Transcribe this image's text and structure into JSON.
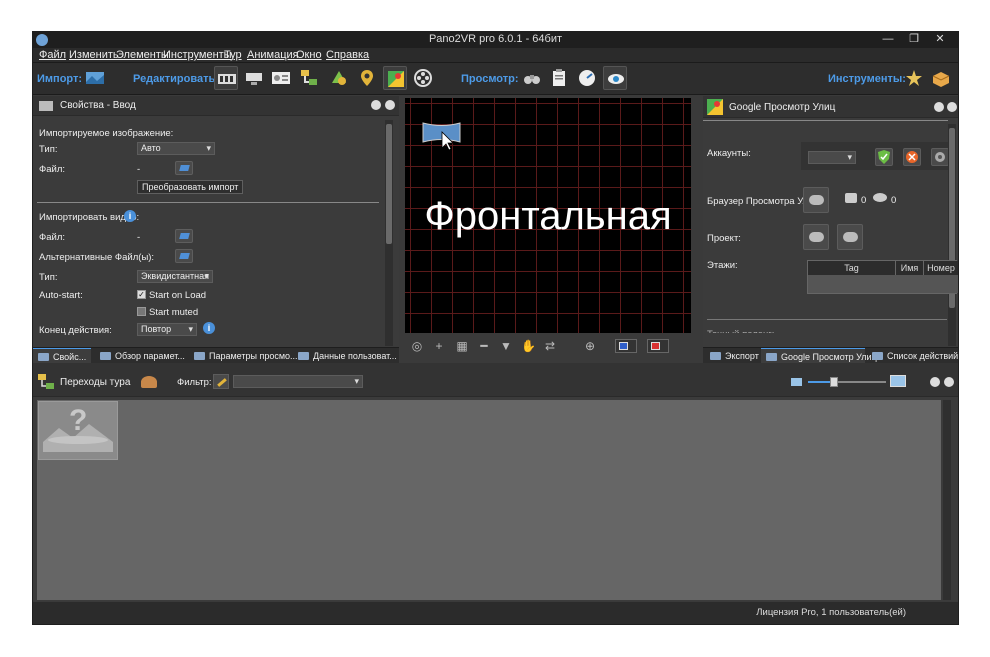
{
  "window": {
    "title": "Pano2VR pro 6.0.1 - 64бит",
    "minimize": "—",
    "maximize": "❐",
    "close": "✕"
  },
  "menu": [
    "Файл",
    "Изменить",
    "Элементы",
    "Инструменты",
    "Тур",
    "Анимация",
    "Окно",
    "Справка"
  ],
  "toolbar": {
    "import_label": "Импорт:",
    "edit_label": "Редактировать:",
    "view_label": "Просмотр:",
    "tools_label": "Инструменты:"
  },
  "left_panel": {
    "title": "Свойства - Ввод",
    "imported_image_label": "Импортируемое изображение:",
    "type_label": "Тип:",
    "type_value": "Авто",
    "file_label": "Файл:",
    "file_value": "-",
    "convert_button": "Преобразовать импорт",
    "import_video_label": "Импортировать видео:",
    "video_file_label": "Файл:",
    "video_file_value": "-",
    "alt_files_label": "Альтернативные Файл(ы):",
    "video_type_label": "Тип:",
    "video_type_value": "Эквидистантная",
    "autostart_label": "Auto-start:",
    "start_on_load": "Start on Load",
    "start_muted": "Start muted",
    "end_action_label": "Конец действия:",
    "end_action_value": "Повтор",
    "tabs": [
      "Свойс...",
      "Обзор парамет...",
      "Параметры просмо...",
      "Данные пользоват..."
    ]
  },
  "viewer": {
    "face_label": "Фронтальная"
  },
  "right_panel": {
    "title": "Google Просмотр Улиц",
    "accounts_label": "Аккаунты:",
    "browser_label": "Браузер Просмотра Улиц:",
    "photos_count": "0",
    "views_count": "0",
    "project_label": "Проект:",
    "floors_label": "Этажи:",
    "table_headers": [
      "Tag",
      "Имя",
      "Номер"
    ],
    "cut_label": "Точный пеленг:",
    "tabs": [
      "Экспорт",
      "Google Просмотр Улиц",
      "Список действий"
    ]
  },
  "tour": {
    "title": "Переходы тура",
    "filter_label": "Фильтр:",
    "thumb_placeholder": "?"
  },
  "status": {
    "text": "Лицензия Pro, 1 пользователь(ей)"
  }
}
